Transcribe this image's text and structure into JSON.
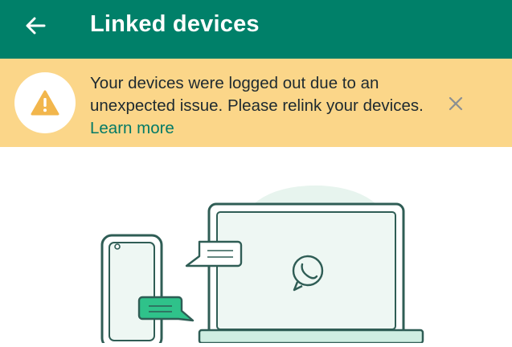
{
  "appbar": {
    "title": "Linked devices",
    "back_icon": "arrow-left-icon",
    "background": "#008069"
  },
  "banner": {
    "message": "Your devices were logged out due to an unexpected issue. Please relink your devices.",
    "link_label": "Learn more",
    "icon": "warning-icon",
    "close_icon": "close-icon",
    "background": "#fbd689",
    "link_color": "#027a66"
  },
  "illustration": {
    "name": "linked-devices-illustration",
    "accent": "#25d366",
    "stroke": "#2f5d55"
  }
}
